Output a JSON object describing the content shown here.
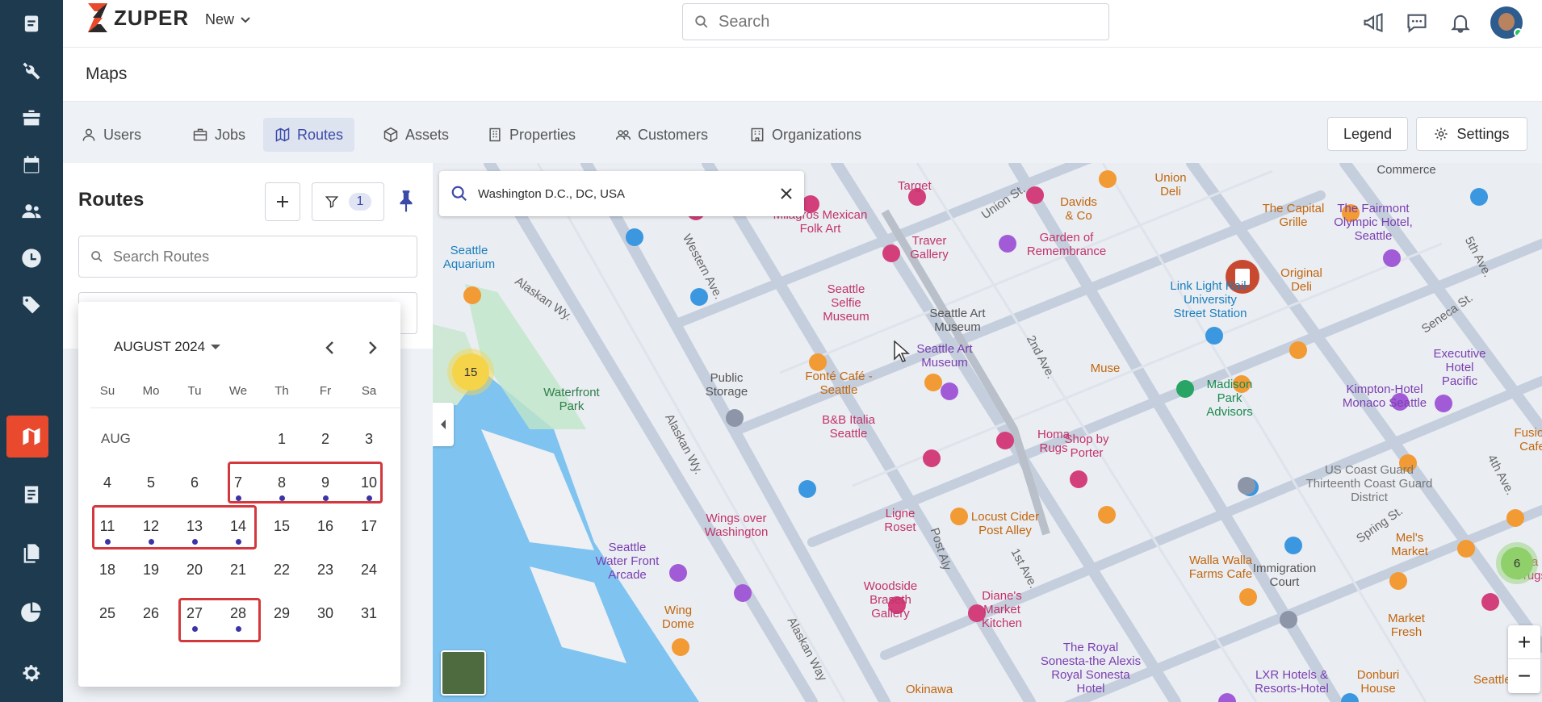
{
  "app": {
    "logo_text": "ZUPER",
    "new_label": "New",
    "search_placeholder": "Search",
    "page_title": "Maps"
  },
  "rail": {
    "items": [
      "jobs-icon",
      "tools-icon",
      "inventory-icon",
      "calendar-icon",
      "customers-icon",
      "timesheet-icon",
      "tag-icon",
      "maps-icon",
      "invoice-icon",
      "documents-icon",
      "reports-icon",
      "settings-icon"
    ],
    "active": "maps-icon"
  },
  "tabs": [
    {
      "label": "Users",
      "icon": "user-icon"
    },
    {
      "label": "Jobs",
      "icon": "briefcase-icon"
    },
    {
      "label": "Routes",
      "icon": "map-icon",
      "active": true
    },
    {
      "label": "Assets",
      "icon": "cube-icon"
    },
    {
      "label": "Properties",
      "icon": "building-icon"
    },
    {
      "label": "Customers",
      "icon": "group-icon"
    },
    {
      "label": "Organizations",
      "icon": "organization-icon"
    }
  ],
  "header_buttons": {
    "legend": "Legend",
    "settings": "Settings"
  },
  "routes_panel": {
    "title": "Routes",
    "filter_count": "1",
    "search_placeholder": "Search Routes"
  },
  "calendar": {
    "month_label": "AUGUST 2024",
    "month_short": "AUG",
    "weekdays": [
      "Su",
      "Mo",
      "Tu",
      "We",
      "Th",
      "Fr",
      "Sa"
    ],
    "days": [
      {
        "d": "1",
        "dot": false
      },
      {
        "d": "2",
        "dot": false
      },
      {
        "d": "3",
        "dot": false
      },
      {
        "d": "4",
        "dot": false
      },
      {
        "d": "5",
        "dot": false
      },
      {
        "d": "6",
        "dot": false
      },
      {
        "d": "7",
        "dot": true
      },
      {
        "d": "8",
        "dot": true
      },
      {
        "d": "9",
        "dot": true
      },
      {
        "d": "10",
        "dot": true
      },
      {
        "d": "11",
        "dot": true
      },
      {
        "d": "12",
        "dot": true
      },
      {
        "d": "13",
        "dot": true
      },
      {
        "d": "14",
        "dot": true
      },
      {
        "d": "15",
        "dot": false
      },
      {
        "d": "16",
        "dot": false
      },
      {
        "d": "17",
        "dot": false
      },
      {
        "d": "18",
        "dot": false
      },
      {
        "d": "19",
        "dot": false
      },
      {
        "d": "20",
        "dot": false
      },
      {
        "d": "21",
        "dot": false
      },
      {
        "d": "22",
        "dot": false
      },
      {
        "d": "23",
        "dot": false
      },
      {
        "d": "24",
        "dot": false
      },
      {
        "d": "25",
        "dot": false
      },
      {
        "d": "26",
        "dot": false
      },
      {
        "d": "27",
        "dot": true
      },
      {
        "d": "28",
        "dot": true
      },
      {
        "d": "29",
        "dot": false
      },
      {
        "d": "30",
        "dot": false
      },
      {
        "d": "31",
        "dot": false
      }
    ]
  },
  "map": {
    "search_value": "Washington D.C., DC, USA",
    "clusters": [
      "15",
      "6"
    ],
    "labels": [
      "Target",
      "Union Deli",
      "Davids & Co",
      "The Capital Grille",
      "The Fairmont Olympic Hotel, Seattle",
      "Milagros Mexican Folk Art",
      "Traver Gallery",
      "Garden of Remembrance",
      "Seattle Aquarium",
      "Link Light Rail-University Street Station",
      "Original Deli",
      "Seattle Selfie Museum",
      "Seattle Art Museum",
      "Public Storage",
      "Fonté Café - Seattle",
      "Muse",
      "Madison Park Advisors",
      "Executive Hotel Pacific",
      "Kimpton-Hotel Monaco Seattle",
      "Waterfront Park",
      "B&B Italia Seattle",
      "Homa Rugs",
      "Shop by Porter",
      "US Coast Guard Thirteenth Coast Guard District",
      "Fusion Cafe",
      "Wings over Washington",
      "Ligne Roset",
      "Locust Cider Post Alley",
      "Seattle Water Front Arcade",
      "Walla Walla Farms Cafe",
      "Mel's Market",
      "Immigration Court",
      "Woodside Braseth Gallery",
      "Diane's Market Kitchen",
      "Market Fresh",
      "Wing Dome",
      "The Royal Sonesta-the Alexis Royal Sonesta Hotel",
      "LXR Hotels & Resorts-Hotel",
      "Donburi House",
      "Seattle Hu",
      "Okinawa",
      "Ba Drugs",
      "Commerce"
    ],
    "streets": [
      "Union St.",
      "Western Ave.",
      "Alaskan Wy.",
      "2nd Ave.",
      "1st Ave.",
      "Post Aly",
      "Spring St.",
      "Seneca St.",
      "4th Ave.",
      "5th Ave.",
      "Alaskan Way"
    ],
    "zoom_in": "+",
    "zoom_out": "−"
  },
  "colors": {
    "rail_bg": "#1d3a4f",
    "accent": "#e9492c",
    "tab_active": "#3b4aa8",
    "selection": "#d3383d",
    "dot": "#3b34a6"
  }
}
